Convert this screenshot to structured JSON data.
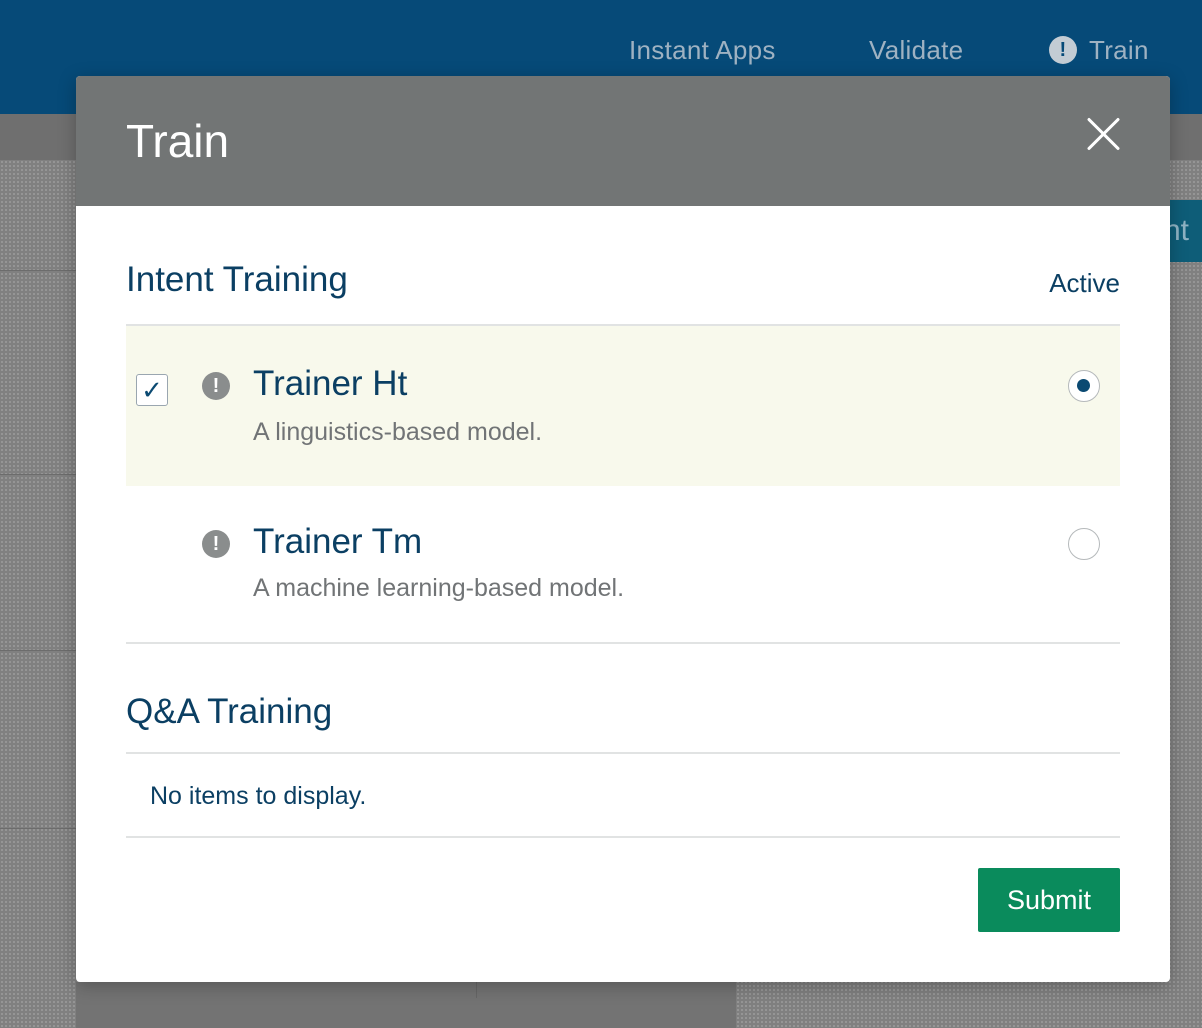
{
  "nav": {
    "instant_apps": "Instant Apps",
    "validate": "Validate",
    "train": "Train",
    "alert_glyph": "!"
  },
  "background": {
    "partial_button_text": "nt"
  },
  "modal": {
    "title": "Train",
    "intent": {
      "title": "Intent Training",
      "column_label": "Active",
      "trainers": [
        {
          "name": "Trainer Ht",
          "description": "A linguistics-based model.",
          "checked": true,
          "active": true,
          "status_icon": "alert-icon"
        },
        {
          "name": "Trainer Tm",
          "description": "A machine learning-based model.",
          "checked": false,
          "active": false,
          "status_icon": "alert-icon"
        }
      ]
    },
    "qa": {
      "title": "Q&A Training",
      "empty_message": "No items to display."
    },
    "submit_label": "Submit",
    "check_glyph": "✓",
    "warn_glyph": "!"
  },
  "colors": {
    "nav_bar": "#064a78",
    "modal_header": "#727575",
    "primary_text": "#0b3f63",
    "selected_row": "#f8f9ec",
    "submit_button": "#0a8b5c"
  }
}
